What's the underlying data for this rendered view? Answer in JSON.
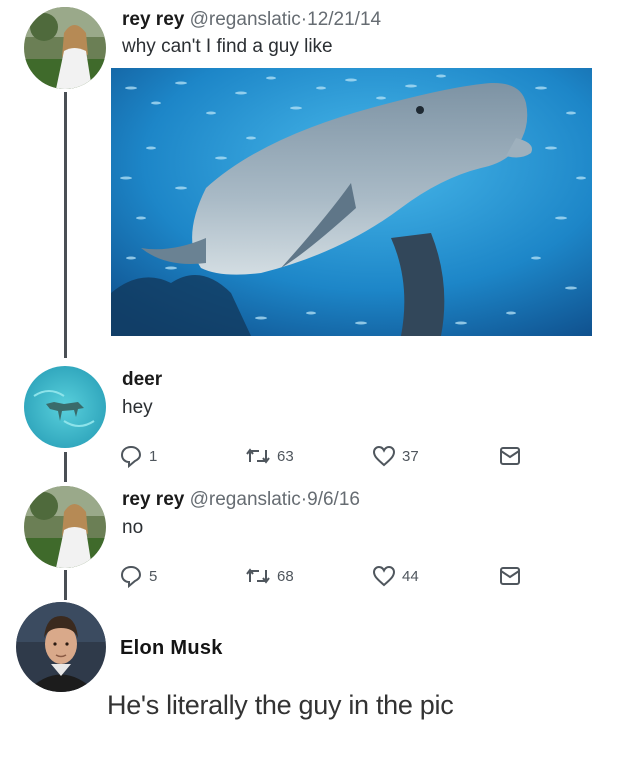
{
  "tweet1": {
    "display_name": "rey rey",
    "handle": "@reganslatic",
    "separator": "·",
    "date": "12/21/14",
    "text": "why can't I find a guy like",
    "media_icon": "dolphin-photo"
  },
  "reply1": {
    "display_name": "deer",
    "text": "hey",
    "actions": {
      "replies": "1",
      "retweets": "63",
      "likes": "37"
    }
  },
  "reply2": {
    "display_name": "rey rey",
    "handle": "@reganslatic",
    "separator": "·",
    "date": "9/6/16",
    "text": "no",
    "actions": {
      "replies": "5",
      "retweets": "68",
      "likes": "44"
    }
  },
  "comment": {
    "display_name": "Elon Musk",
    "text": "He's literally the guy in the pic"
  },
  "icons": {
    "reply": "reply-icon",
    "retweet": "retweet-icon",
    "like": "heart-icon",
    "dm": "envelope-icon"
  },
  "colors": {
    "ocean": "#1f8fd0",
    "thread_line": "#4a4f55",
    "action_gray": "#4f565d"
  }
}
